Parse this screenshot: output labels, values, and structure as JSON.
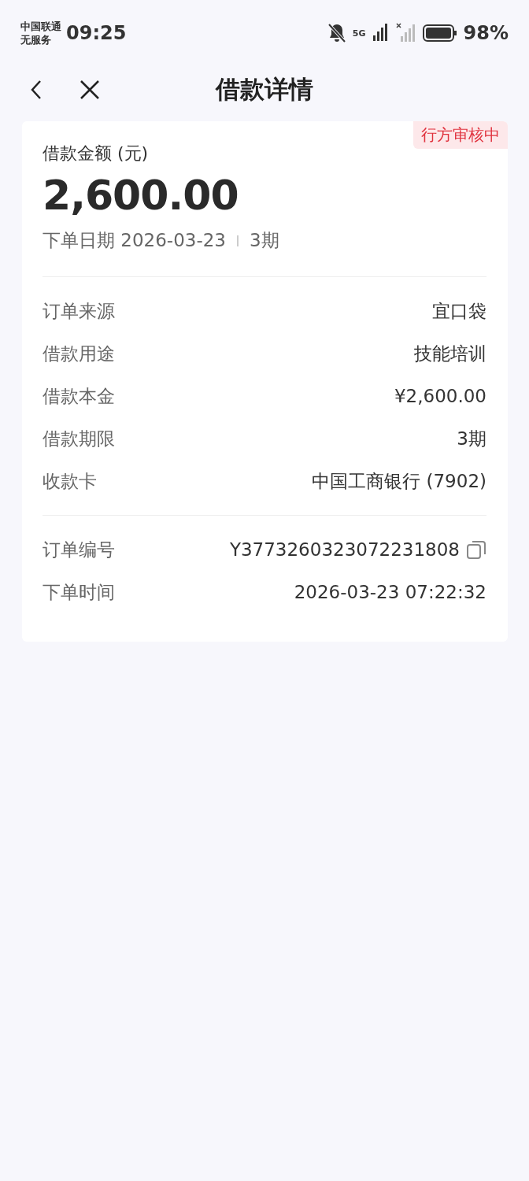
{
  "status_bar": {
    "carrier": "中国联通",
    "service": "无服务",
    "time": "09:25",
    "network": "5G",
    "battery": "98%"
  },
  "nav": {
    "title": "借款详情"
  },
  "card": {
    "badge": "行方审核中",
    "amount_label": "借款金额 (元)",
    "amount": "2,600.00",
    "date_label": "下单日期 2026-03-23",
    "term": "3期",
    "sections": [
      [
        {
          "label": "订单来源",
          "value": "宜口袋",
          "kind": "plain"
        },
        {
          "label": "借款用途",
          "value": "技能培训",
          "kind": "plain"
        },
        {
          "label": "借款本金",
          "value": "¥2,600.00",
          "kind": "plain"
        },
        {
          "label": "借款期限",
          "value": "3期",
          "kind": "plain"
        },
        {
          "label": "收款卡",
          "value": "中国工商银行 (7902)",
          "kind": "plain"
        }
      ],
      [
        {
          "label": "订单编号",
          "value": "Y3773260323072231808",
          "kind": "copy"
        },
        {
          "label": "下单时间",
          "value": "2026-03-23 07:22:32",
          "kind": "plain"
        }
      ]
    ]
  }
}
